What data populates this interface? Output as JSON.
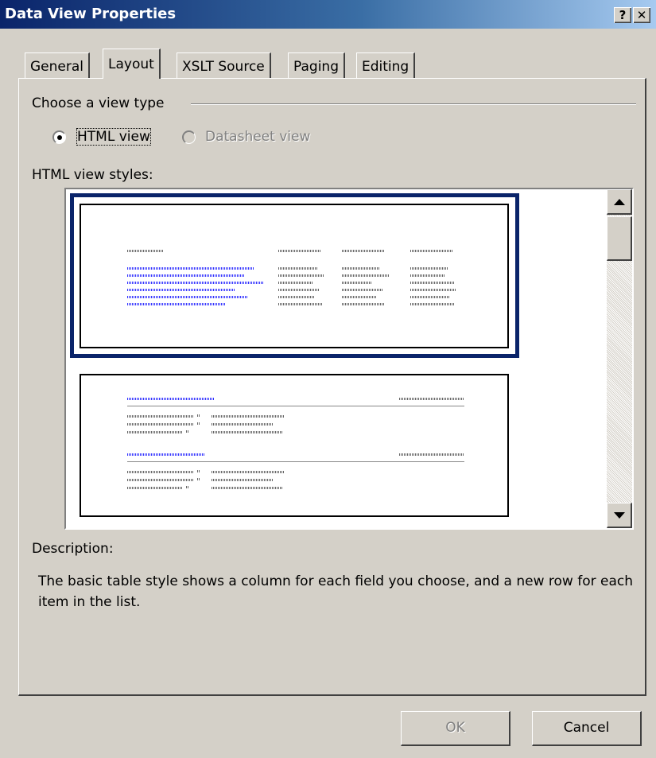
{
  "window": {
    "title": "Data View Properties",
    "help_label": "?",
    "close_label": "✕"
  },
  "tabs": [
    {
      "label": "General"
    },
    {
      "label": "Layout"
    },
    {
      "label": "XSLT Source"
    },
    {
      "label": "Paging"
    },
    {
      "label": "Editing"
    }
  ],
  "view_type": {
    "group_label": "Choose a view type",
    "options": [
      {
        "label": "HTML view",
        "selected": true,
        "enabled": true
      },
      {
        "label": "Datasheet view",
        "selected": false,
        "enabled": false
      }
    ]
  },
  "styles": {
    "label": "HTML view styles:",
    "selected_index": 0,
    "scroll_up_icon": "arrow-up-icon",
    "scroll_down_icon": "arrow-down-icon"
  },
  "description": {
    "label": "Description:",
    "text": "The basic table style shows a column for each field you choose, and a new row for each item in the list."
  },
  "buttons": {
    "ok_label": "OK",
    "cancel_label": "Cancel"
  },
  "colors": {
    "title_bar": "#0a246a",
    "selection_frame": "#0a246a",
    "dialog_face": "#d4d0c8"
  }
}
